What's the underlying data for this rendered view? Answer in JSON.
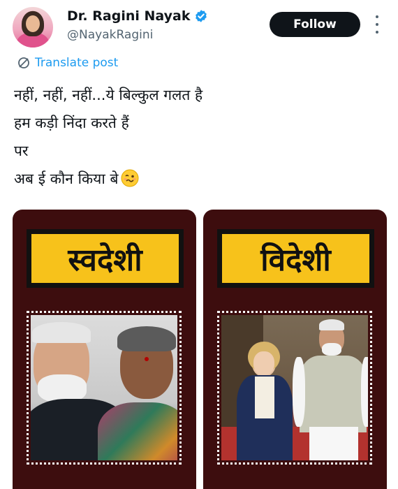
{
  "author": {
    "name": "Dr. Ragini Nayak",
    "handle": "@NayakRagini",
    "verified_color": "#1d9bf0"
  },
  "actions": {
    "follow_label": "Follow"
  },
  "translate": {
    "label": "Translate post"
  },
  "tweet": {
    "lines": [
      "नहीं, नहीं, नहीं...ये बिल्कुल गलत है",
      "हम कड़ी निंदा करते हैं",
      "पर",
      "अब ई कौन किया बे"
    ],
    "emoji": "woozy-face-icon"
  },
  "media": {
    "left_label": "स्वदेशी",
    "right_label": "विदेशी",
    "panel_color": "#3d0d0e",
    "label_color": "#f7c21b"
  }
}
